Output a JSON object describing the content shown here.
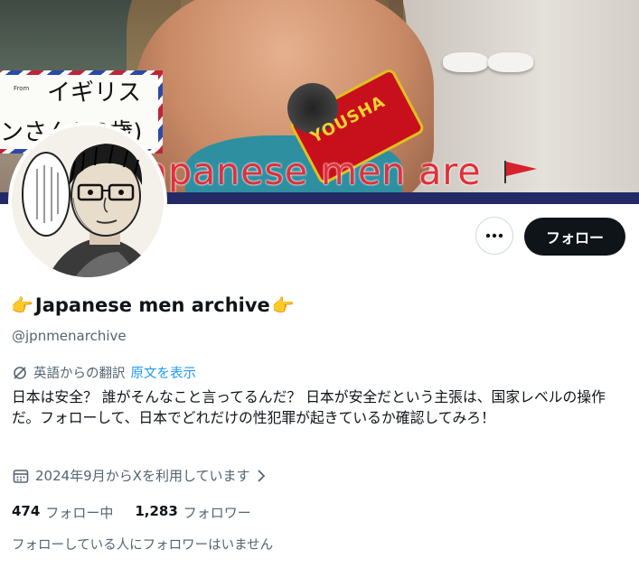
{
  "banner": {
    "caption": "apanese men are",
    "card_from": "From",
    "card_name": "イギリス",
    "card_sub": "ンさん(22歳)",
    "mic_text": "YOUSHA"
  },
  "actions": {
    "more_label": "•••",
    "follow_label": "フォロー"
  },
  "profile": {
    "name": "Japanese men archive",
    "name_emoji_left": "👉",
    "name_emoji_right": "👉",
    "handle": "@jpnmenarchive",
    "translate_label": "英語からの翻訳",
    "translate_link": "原文を表示",
    "bio": "日本は安全？ 誰がそんなこと言ってるんだ？ 日本が安全だという主張は、国家レベルの操作だ。フォローして、日本でどれだけの性犯罪が起きているか確認してみろ！",
    "joined": "2024年9月からXを利用しています"
  },
  "stats": {
    "following_count": "474",
    "following_label": "フォロー中",
    "followers_count": "1,283",
    "followers_label": "フォロワー"
  },
  "followers_you_know": "フォローしている人にフォロワーはいません",
  "colors": {
    "accent": "#1d9bf0",
    "text": "#0f1419",
    "secondary": "#536471",
    "button_dark": "#0f1419"
  }
}
